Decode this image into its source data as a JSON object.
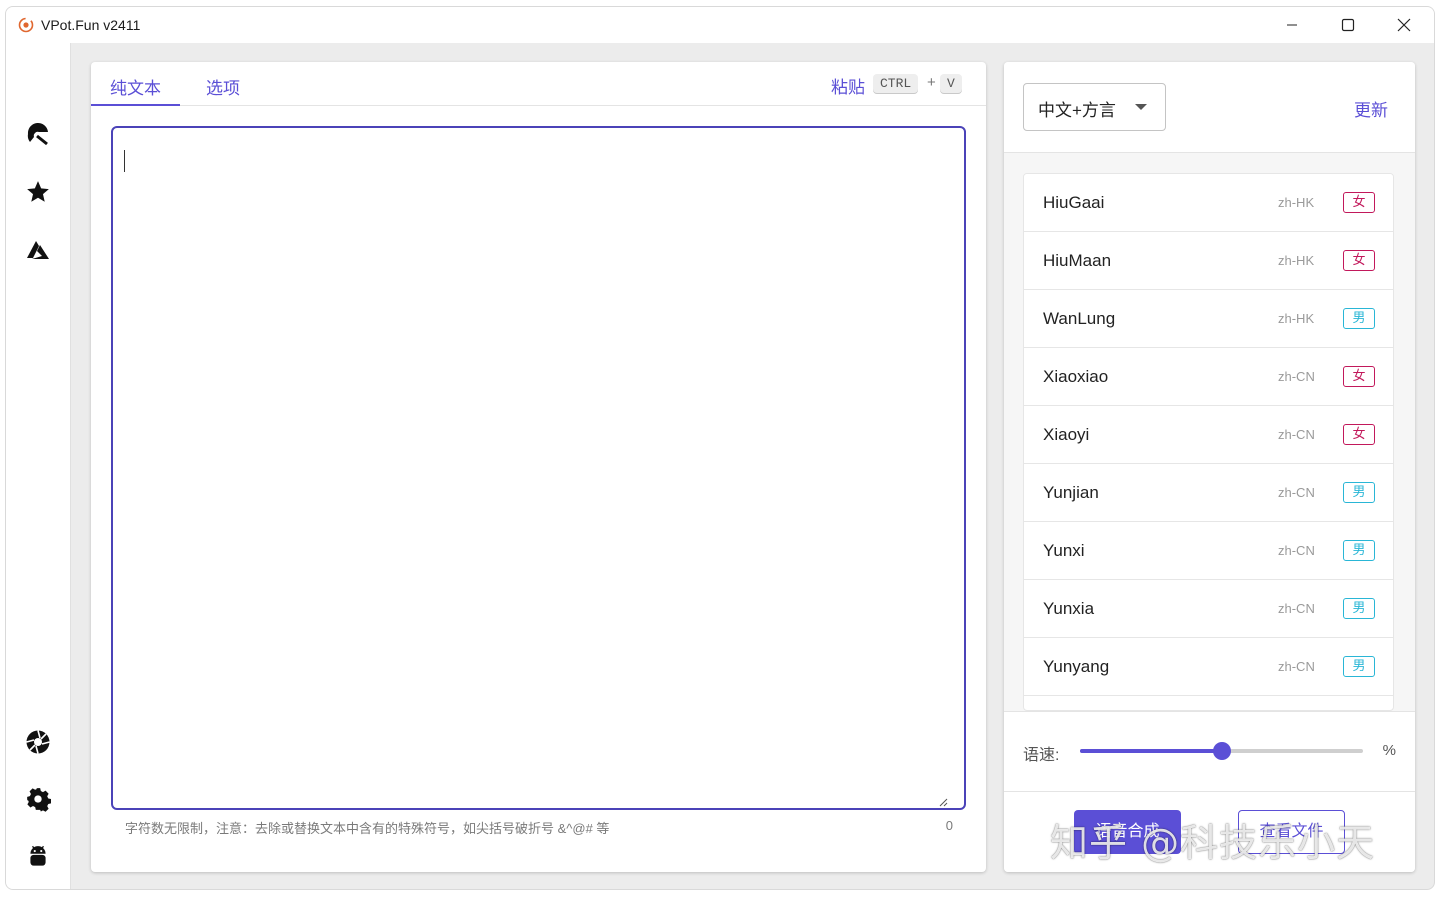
{
  "window": {
    "title": "VPot.Fun v2411"
  },
  "sidebar": {
    "top_icons": [
      "microsoft-edge-icon",
      "star-icon",
      "azure-icon"
    ],
    "bottom_icons": [
      "aperture-icon",
      "gear-icon",
      "android-icon"
    ]
  },
  "editor": {
    "tabs": [
      {
        "label": "纯文本",
        "active": true
      },
      {
        "label": "选项",
        "active": false
      }
    ],
    "paste_label": "粘贴",
    "shortcut_ctrl": "CTRL",
    "shortcut_plus": "+",
    "shortcut_v": "V",
    "text_value": "",
    "hint": "字符数无限制，注意：去除或替换文本中含有的特殊符号，如尖括号破折号 &^@# 等",
    "char_count": "0"
  },
  "voices": {
    "language_select": "中文+方言",
    "update_label": "更新",
    "items": [
      {
        "name": "HiuGaai",
        "locale": "zh-HK",
        "gender": "女",
        "gender_type": "f"
      },
      {
        "name": "HiuMaan",
        "locale": "zh-HK",
        "gender": "女",
        "gender_type": "f"
      },
      {
        "name": "WanLung",
        "locale": "zh-HK",
        "gender": "男",
        "gender_type": "m"
      },
      {
        "name": "Xiaoxiao",
        "locale": "zh-CN",
        "gender": "女",
        "gender_type": "f"
      },
      {
        "name": "Xiaoyi",
        "locale": "zh-CN",
        "gender": "女",
        "gender_type": "f"
      },
      {
        "name": "Yunjian",
        "locale": "zh-CN",
        "gender": "男",
        "gender_type": "m"
      },
      {
        "name": "Yunxi",
        "locale": "zh-CN",
        "gender": "男",
        "gender_type": "m"
      },
      {
        "name": "Yunxia",
        "locale": "zh-CN",
        "gender": "男",
        "gender_type": "m"
      },
      {
        "name": "Yunyang",
        "locale": "zh-CN",
        "gender": "男",
        "gender_type": "m"
      }
    ]
  },
  "speed": {
    "label": "语速:",
    "unit": "%",
    "fraction": 0.5
  },
  "actions": {
    "synthesize_label": "语音合成",
    "open_file_label": "查看文件"
  },
  "watermark": "知乎 @科技乐小天",
  "colors": {
    "accent": "#5b4fd6",
    "female": "#c2185b",
    "male": "#29b6d6"
  }
}
